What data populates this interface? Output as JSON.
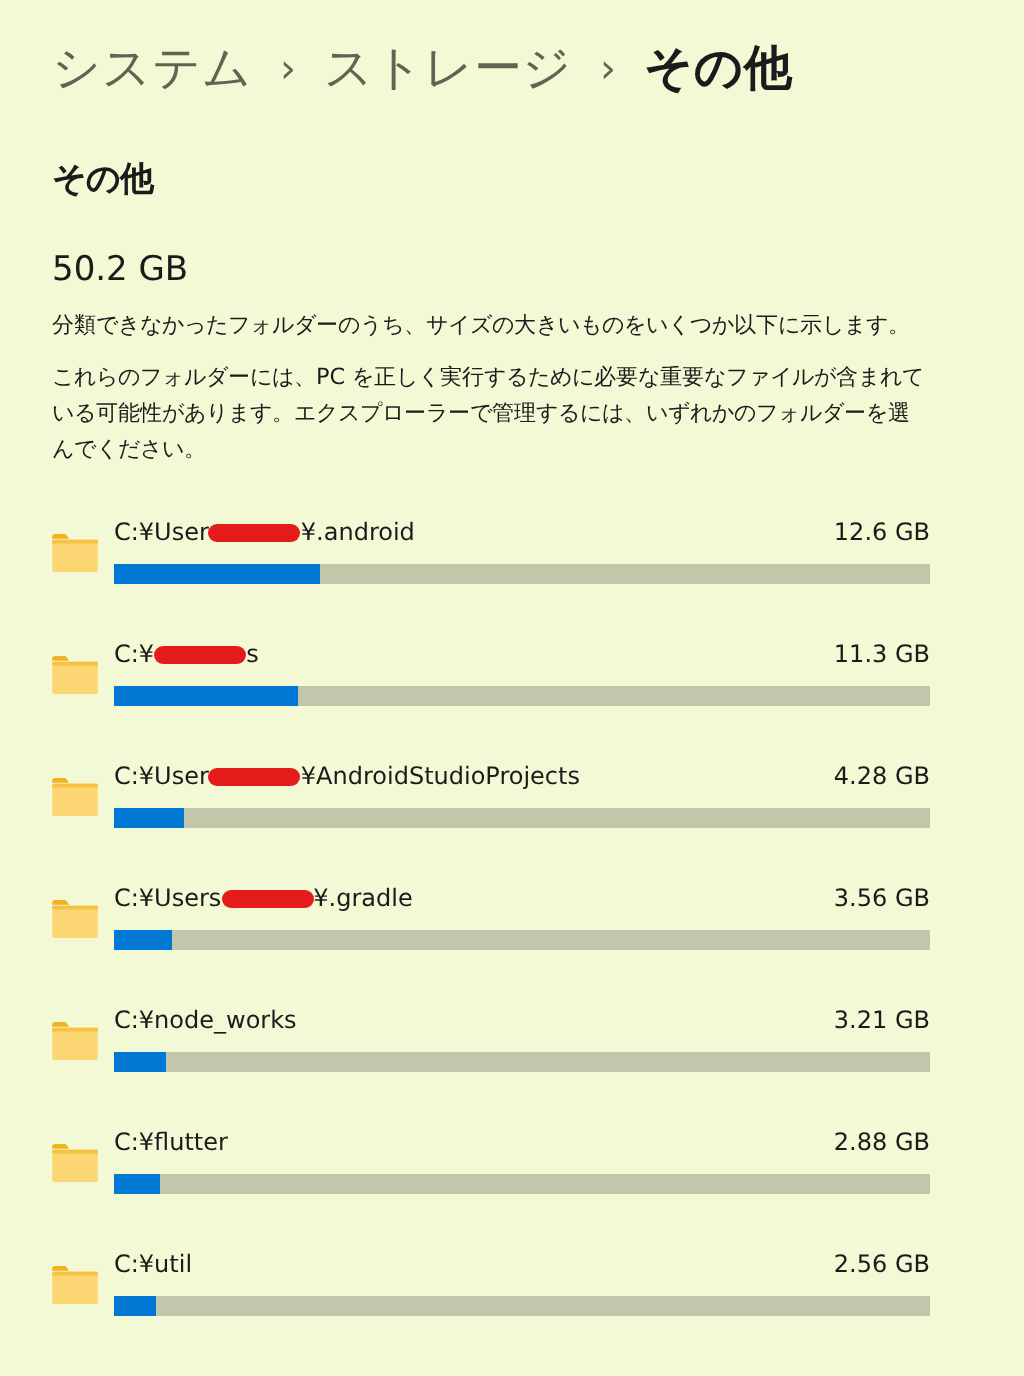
{
  "breadcrumb": [
    {
      "label": "システム",
      "current": false
    },
    {
      "label": "ストレージ",
      "current": false
    },
    {
      "label": "その他",
      "current": true
    }
  ],
  "separator": "›",
  "heading": "その他",
  "total": "50.2 GB",
  "description": [
    "分類できなかったフォルダーのうち、サイズの大きいものをいくつか以下に示します。",
    "これらのフォルダーには、PC を正しく実行するために必要な重要なファイルが含まれている可能性があります。エクスプローラーで管理するには、いずれかのフォルダーを選んでください。"
  ],
  "folders": [
    {
      "path_start": "C:¥User",
      "path_end": "¥.android",
      "redacted": true,
      "size": "12.6 GB",
      "level": 0.252
    },
    {
      "path_start": "C:¥",
      "path_end": "s",
      "redacted": true,
      "size": "11.3 GB",
      "level": 0.225
    },
    {
      "path_start": "C:¥User",
      "path_end": "¥AndroidStudioProjects",
      "redacted": true,
      "size": "4.28 GB",
      "level": 0.086
    },
    {
      "path_start": "C:¥Users",
      "path_end": "¥.gradle",
      "redacted": true,
      "size": "3.56 GB",
      "level": 0.071
    },
    {
      "path_start": "C:¥node_works",
      "redacted": false,
      "size": "3.21 GB",
      "level": 0.064
    },
    {
      "path_start": "C:¥flutter",
      "redacted": false,
      "size": "2.88 GB",
      "level": 0.056
    },
    {
      "path_start": "C:¥util",
      "redacted": false,
      "size": "2.56 GB",
      "level": 0.051
    }
  ]
}
